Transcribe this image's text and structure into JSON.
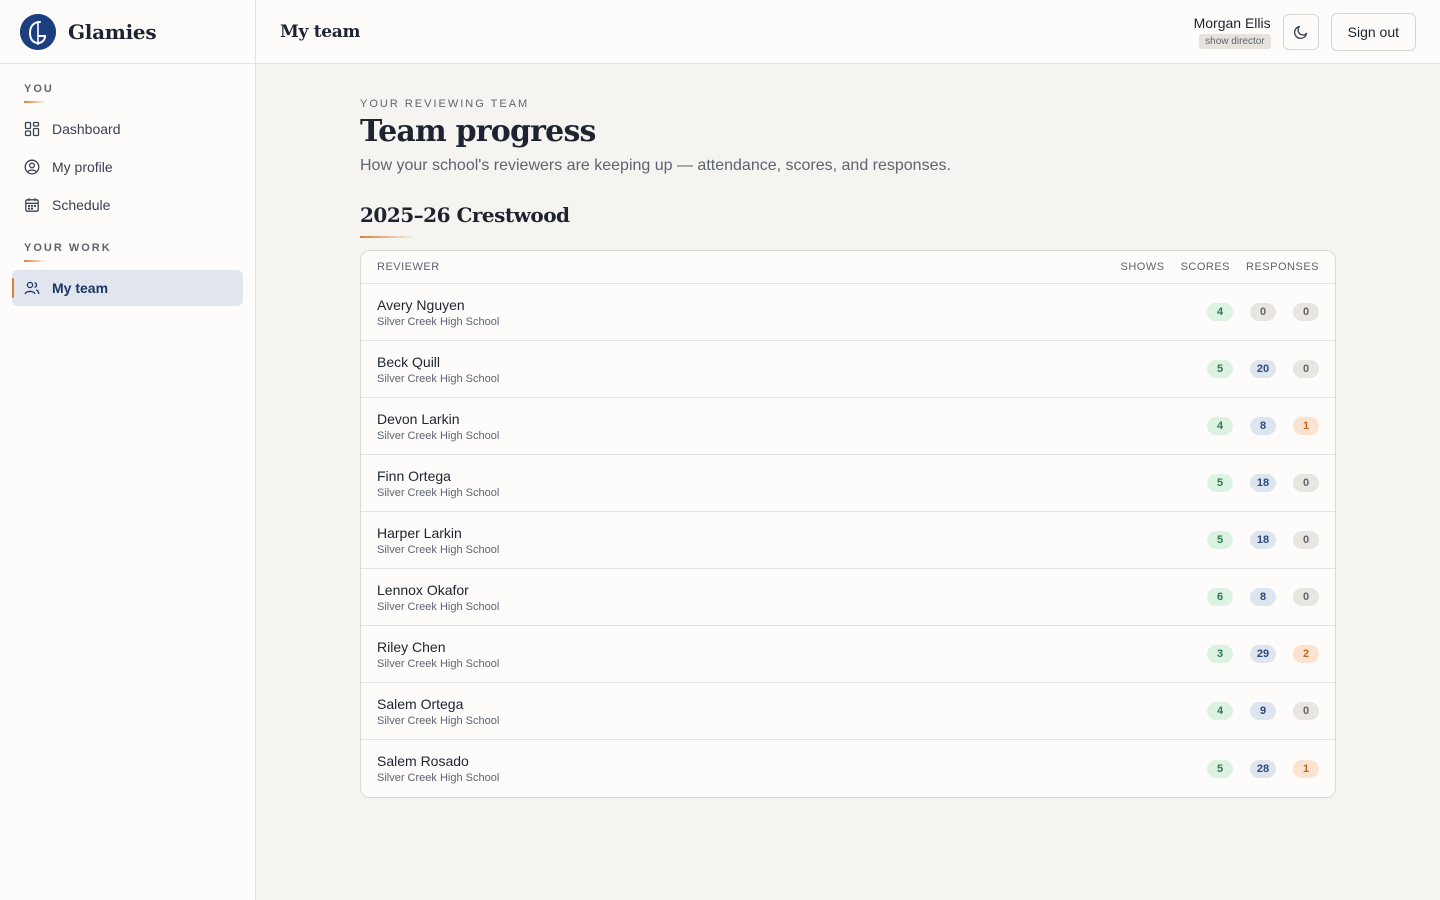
{
  "brand": {
    "name": "Glamies"
  },
  "sidebar": {
    "sections": [
      {
        "heading": "YOU",
        "items": [
          {
            "label": "Dashboard",
            "icon": "dashboard-icon"
          },
          {
            "label": "My profile",
            "icon": "user-circle-icon"
          },
          {
            "label": "Schedule",
            "icon": "calendar-icon"
          }
        ]
      },
      {
        "heading": "YOUR WORK",
        "items": [
          {
            "label": "My team",
            "icon": "users-icon",
            "active": true
          }
        ]
      }
    ]
  },
  "header": {
    "title": "My team",
    "user_name": "Morgan Ellis",
    "user_role": "show director",
    "theme_icon": "moon-icon",
    "signout_label": "Sign out"
  },
  "main": {
    "eyebrow": "YOUR REVIEWING TEAM",
    "title": "Team progress",
    "subtitle": "How your school's reviewers are keeping up — attendance, scores, and responses.",
    "season": "2025–26 Crestwood"
  },
  "table": {
    "columns": {
      "reviewer": "REVIEWER",
      "shows": "SHOWS",
      "scores": "SCORES",
      "responses": "RESPONSES"
    },
    "rows": [
      {
        "name": "Avery Nguyen",
        "school": "Silver Creek High School",
        "shows": "4",
        "scores": "0",
        "responses": "0"
      },
      {
        "name": "Beck Quill",
        "school": "Silver Creek High School",
        "shows": "5",
        "scores": "20",
        "responses": "0"
      },
      {
        "name": "Devon Larkin",
        "school": "Silver Creek High School",
        "shows": "4",
        "scores": "8",
        "responses": "1"
      },
      {
        "name": "Finn Ortega",
        "school": "Silver Creek High School",
        "shows": "5",
        "scores": "18",
        "responses": "0"
      },
      {
        "name": "Harper Larkin",
        "school": "Silver Creek High School",
        "shows": "5",
        "scores": "18",
        "responses": "0"
      },
      {
        "name": "Lennox Okafor",
        "school": "Silver Creek High School",
        "shows": "6",
        "scores": "8",
        "responses": "0"
      },
      {
        "name": "Riley Chen",
        "school": "Silver Creek High School",
        "shows": "3",
        "scores": "29",
        "responses": "2"
      },
      {
        "name": "Salem Ortega",
        "school": "Silver Creek High School",
        "shows": "4",
        "scores": "9",
        "responses": "0"
      },
      {
        "name": "Salem Rosado",
        "school": "Silver Creek High School",
        "shows": "5",
        "scores": "28",
        "responses": "1"
      }
    ]
  },
  "colors": {
    "accent": "#d7813a",
    "brand": "#1c3f7f"
  }
}
